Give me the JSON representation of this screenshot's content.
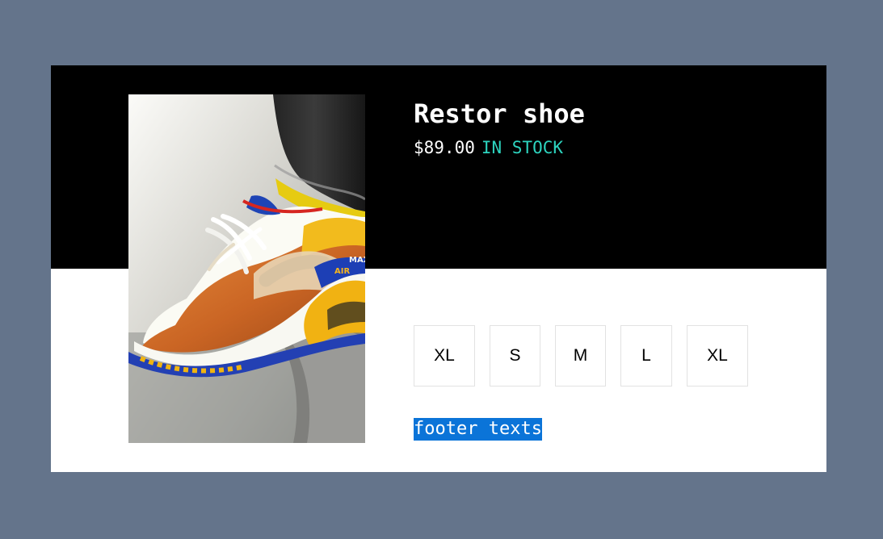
{
  "product": {
    "title": "Restor shoe",
    "price": "$89.00",
    "stock_status": "IN STOCK",
    "image_alt": "shoe-photo",
    "sizes": [
      "XL",
      "S",
      "M",
      "L",
      "XL"
    ]
  },
  "footer": {
    "text": "footer texts"
  },
  "colors": {
    "page_background": "#64748b",
    "card_top_background": "#000000",
    "card_bottom_background": "#ffffff",
    "stock_status": "#2dd4bf",
    "footer_highlight": "#0b74d8"
  }
}
